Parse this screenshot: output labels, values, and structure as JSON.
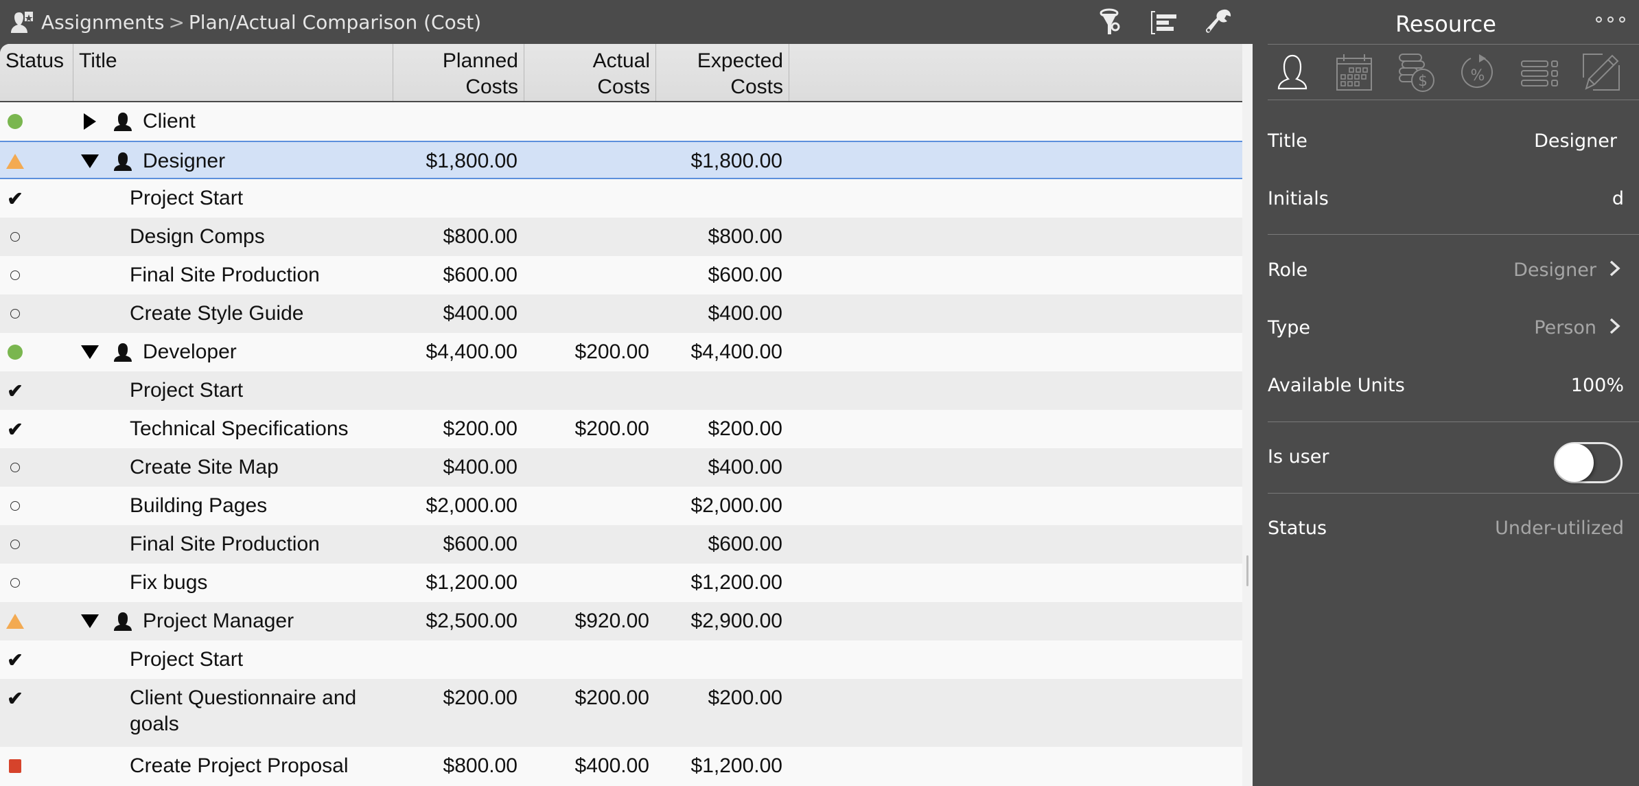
{
  "toolbar": {
    "breadcrumb": [
      "Assignments",
      "Plan/Actual Comparison (Cost)"
    ],
    "breadcrumb_icon": "assignments-icon",
    "icons": [
      "filter-icon",
      "outline-view-icon",
      "wrench-icon"
    ]
  },
  "table": {
    "columns": [
      "Status",
      "Title",
      "Planned\nCosts",
      "Actual\nCosts",
      "Expected\nCosts"
    ],
    "columns_display": {
      "status": "Status",
      "title": "Title",
      "planned_line1": "Planned",
      "planned_line2": "Costs",
      "actual_line1": "Actual",
      "actual_line2": "Costs",
      "expected_line1": "Expected",
      "expected_line2": "Costs"
    },
    "rows": [
      {
        "status": "green-dot",
        "type": "resource",
        "expanded": false,
        "title": "Client",
        "planned": "",
        "actual": "",
        "expected": ""
      },
      {
        "status": "orange-triangle",
        "type": "resource",
        "expanded": true,
        "selected": true,
        "title": "Designer",
        "planned": "$1,800.00",
        "actual": "",
        "expected": "$1,800.00"
      },
      {
        "status": "check",
        "type": "task",
        "title": "Project Start",
        "planned": "",
        "actual": "",
        "expected": ""
      },
      {
        "status": "open-circle",
        "type": "task",
        "title": "Design Comps",
        "planned": "$800.00",
        "actual": "",
        "expected": "$800.00"
      },
      {
        "status": "open-circle",
        "type": "task",
        "title": "Final Site Production",
        "planned": "$600.00",
        "actual": "",
        "expected": "$600.00"
      },
      {
        "status": "open-circle",
        "type": "task",
        "title": "Create Style Guide",
        "planned": "$400.00",
        "actual": "",
        "expected": "$400.00"
      },
      {
        "status": "green-dot",
        "type": "resource",
        "expanded": true,
        "title": "Developer",
        "planned": "$4,400.00",
        "actual": "$200.00",
        "expected": "$4,400.00"
      },
      {
        "status": "check",
        "type": "task",
        "title": "Project Start",
        "planned": "",
        "actual": "",
        "expected": ""
      },
      {
        "status": "check",
        "type": "task",
        "title": "Technical Specifications",
        "planned": "$200.00",
        "actual": "$200.00",
        "expected": "$200.00"
      },
      {
        "status": "open-circle",
        "type": "task",
        "title": "Create Site Map",
        "planned": "$400.00",
        "actual": "",
        "expected": "$400.00"
      },
      {
        "status": "open-circle",
        "type": "task",
        "title": "Building Pages",
        "planned": "$2,000.00",
        "actual": "",
        "expected": "$2,000.00"
      },
      {
        "status": "open-circle",
        "type": "task",
        "title": "Final Site Production",
        "planned": "$600.00",
        "actual": "",
        "expected": "$600.00"
      },
      {
        "status": "open-circle",
        "type": "task",
        "title": "Fix bugs",
        "planned": "$1,200.00",
        "actual": "",
        "expected": "$1,200.00"
      },
      {
        "status": "orange-triangle",
        "type": "resource",
        "expanded": true,
        "title": "Project Manager",
        "planned": "$2,500.00",
        "actual": "$920.00",
        "expected": "$2,900.00"
      },
      {
        "status": "check",
        "type": "task",
        "title": "Project Start",
        "planned": "",
        "actual": "",
        "expected": ""
      },
      {
        "status": "check",
        "type": "task",
        "title": "Client Questionnaire and",
        "title_line2": "goals",
        "planned": "$200.00",
        "actual": "$200.00",
        "expected": "$200.00"
      },
      {
        "status": "red-square",
        "type": "task",
        "title": "Create Project Proposal",
        "planned": "$800.00",
        "actual": "$400.00",
        "expected": "$1,200.00"
      }
    ]
  },
  "inspector": {
    "title": "Resource",
    "more_icon": "more-icon",
    "tabs": [
      "resource-tab-icon",
      "calendar-tab-icon",
      "cost-tab-icon",
      "percent-tab-icon",
      "list-tab-icon",
      "notes-tab-icon"
    ],
    "active_tab": 0,
    "fields": {
      "title": {
        "label": "Title",
        "value": "Designer"
      },
      "initials": {
        "label": "Initials",
        "value": "d"
      },
      "role": {
        "label": "Role",
        "value": "Designer"
      },
      "type": {
        "label": "Type",
        "value": "Person"
      },
      "available_units": {
        "label": "Available Units",
        "value": "100%"
      },
      "is_user": {
        "label": "Is user",
        "value": false
      },
      "status": {
        "label": "Status",
        "value": "Under-utilized"
      }
    }
  },
  "colors": {
    "chrome": "#4b4b4b",
    "selection": "#d3e1f6",
    "selection_border": "#5b8fdc",
    "status_green": "#7ab64f",
    "status_orange": "#f3aa52",
    "status_red": "#d6432b"
  }
}
